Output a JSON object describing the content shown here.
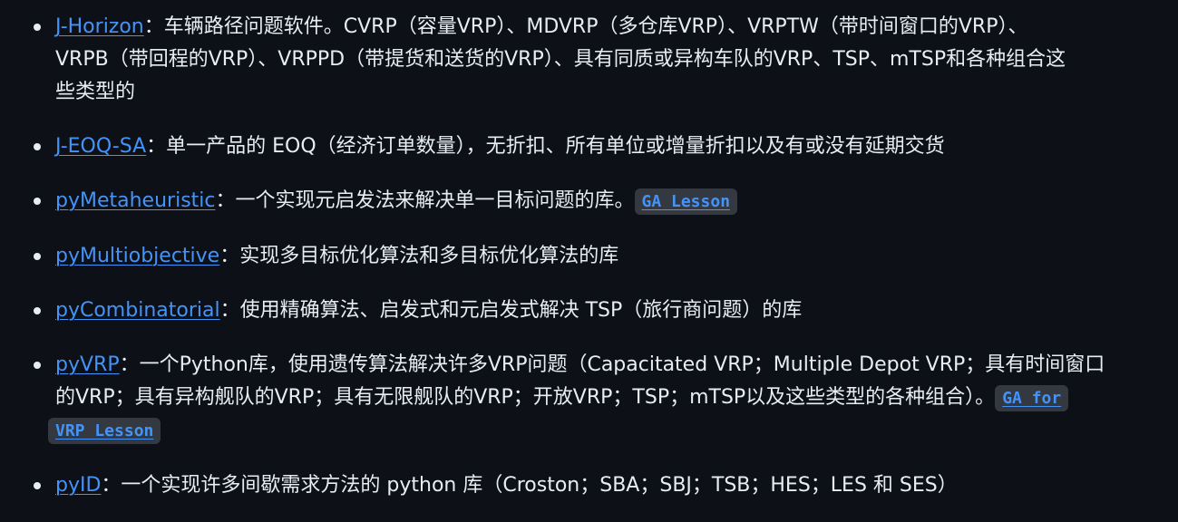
{
  "items": [
    {
      "link": "J-Horizon",
      "lines": [
        "：车辆路径问题软件。CVRP（容量VRP）、MDVRP（多仓库VRP）、VRPTW（带时间窗口的VRP）、",
        "VRPB（带回程的VRP）、VRPPD（带提货和送货的VRP）、具有同质或异构车队的VRP、TSP、mTSP和各种组合这",
        "些类型的"
      ]
    },
    {
      "link": "J-EOQ-SA",
      "lines": [
        "：单一产品的 EOQ（经济订单数量），无折扣、所有单位或增量折扣以及有或没有延期交货"
      ]
    },
    {
      "link": "pyMetaheuristic",
      "text": "：一个实现元启发法来解决单一目标问题的库。",
      "badge": "GA Lesson"
    },
    {
      "link": "pyMultiobjective",
      "text": "：实现多目标优化算法和多目标优化算法的库"
    },
    {
      "link": "pyCombinatorial",
      "text": "：使用精确算法、启发式和元启发式解决 TSP（旅行商问题）的库"
    },
    {
      "link": "pyVRP",
      "line1": "：一个Python库，使用遗传算法解决许多VRP问题（Capacitated VRP；Multiple Depot VRP；具有时间窗口",
      "line2": "的VRP；具有异构舰队的VRP；具有无限舰队的VRP；开放VRP；TSP；mTSP以及这些类型的各种组合）。",
      "badge_part1": "GA for",
      "badge_part2": "VRP Lesson"
    },
    {
      "link": "pyID",
      "text": "：一个实现许多间歇需求方法的 python 库（Croston；SBA；SBJ；TSB；HES；LES 和 SES）"
    }
  ],
  "colors": {
    "background": "#0d1117",
    "text": "#e6edf3",
    "link": "#4493f8",
    "code_bg": "#343941"
  }
}
